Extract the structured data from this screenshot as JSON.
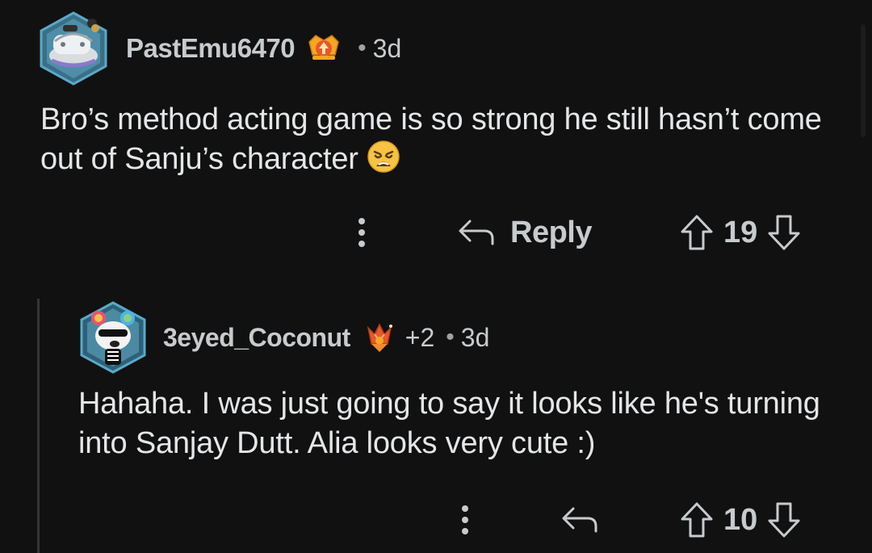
{
  "comments": [
    {
      "username": "PastEmu6470",
      "age": "3d",
      "body": "Bro’s method acting game is so strong he still hasn’t come out of Sanju’s character",
      "body_emoji": "weary-face-emoji",
      "actions": {
        "reply_label": "Reply",
        "score": "19"
      }
    },
    {
      "username": "3eyed_Coconut",
      "extra_flair_count": "+2",
      "age": "3d",
      "body": "Hahaha. I was just going to say it looks like he's turning into Sanjay Dutt. Alia looks very cute :)",
      "actions": {
        "score": "10"
      }
    }
  ],
  "icons": {
    "more": "more-vertical-icon",
    "reply": "reply-arrow-icon",
    "upvote": "upvote-arrow-icon",
    "downvote": "downvote-arrow-icon"
  },
  "colors": {
    "background": "#111111",
    "text": "#e4e6e8",
    "muted": "#c8cbcd",
    "thread_line": "#343536"
  }
}
